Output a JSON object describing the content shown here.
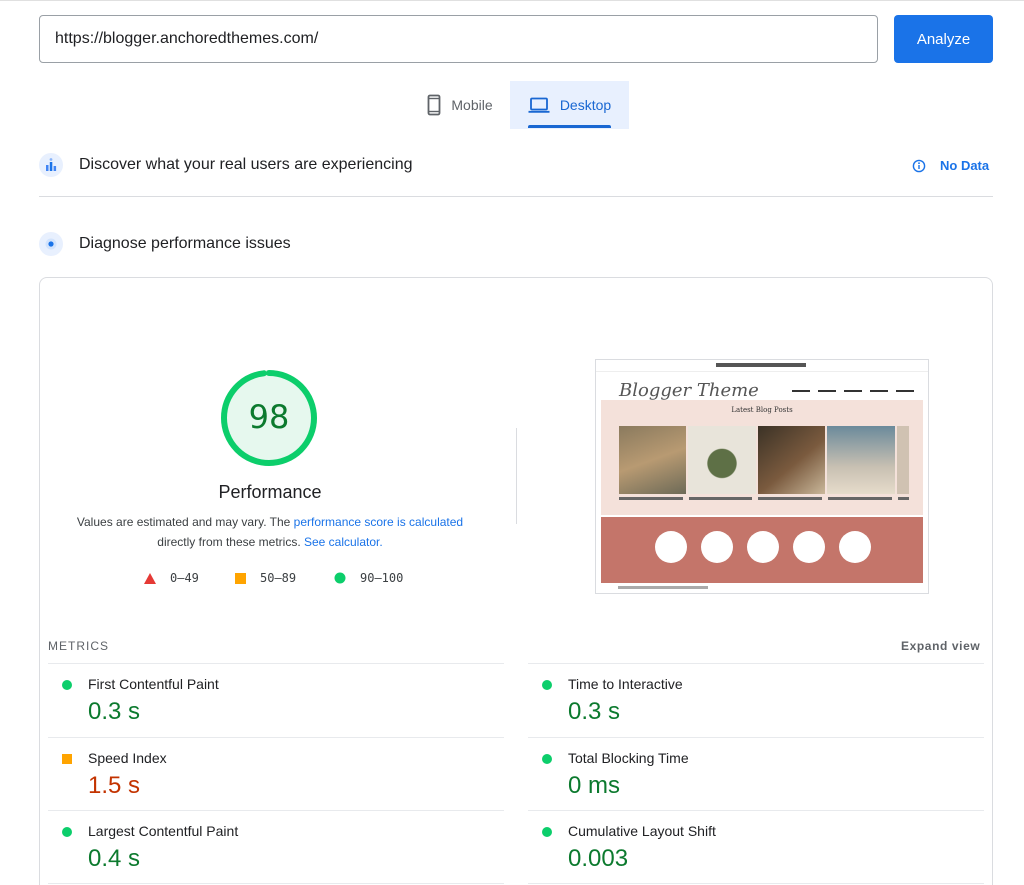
{
  "url_bar": {
    "value": "https://blogger.anchoredthemes.com/",
    "analyze_label": "Analyze"
  },
  "tabs": [
    {
      "label": "Mobile",
      "icon": "phone-icon",
      "selected": false
    },
    {
      "label": "Desktop",
      "icon": "laptop-icon",
      "selected": true
    }
  ],
  "crux": {
    "title": "Discover what your real users are experiencing",
    "status": "No Data",
    "icon": "users-chart-icon"
  },
  "diagnose": {
    "title": "Diagnose performance issues",
    "icon": "diagnose-icon"
  },
  "performance": {
    "score": "98",
    "score_fraction": 0.98,
    "label": "Performance",
    "desc_prefix": "Values are estimated and may vary. The ",
    "desc_link1": "performance score is calculated",
    "desc_middle": " directly from these metrics. ",
    "desc_link2": "See calculator."
  },
  "legend": [
    {
      "range": "0–49",
      "shape": "triangle",
      "color": "#e53935"
    },
    {
      "range": "50–89",
      "shape": "square",
      "color": "#ffa400"
    },
    {
      "range": "90–100",
      "shape": "circle",
      "color": "#0cce6b"
    }
  ],
  "metrics": {
    "heading": "METRICS",
    "expand_label": "Expand view",
    "items": [
      {
        "name": "First Contentful Paint",
        "value": "0.3 s",
        "status": "good"
      },
      {
        "name": "Time to Interactive",
        "value": "0.3 s",
        "status": "good"
      },
      {
        "name": "Speed Index",
        "value": "1.5 s",
        "status": "average"
      },
      {
        "name": "Total Blocking Time",
        "value": "0 ms",
        "status": "good"
      },
      {
        "name": "Largest Contentful Paint",
        "value": "0.4 s",
        "status": "good"
      },
      {
        "name": "Cumulative Layout Shift",
        "value": "0.003",
        "status": "good"
      }
    ]
  },
  "colors": {
    "accent": "#1a73e8",
    "good": "#0c7a2e",
    "average": "#c33300",
    "gauge": "#0cce6b"
  }
}
